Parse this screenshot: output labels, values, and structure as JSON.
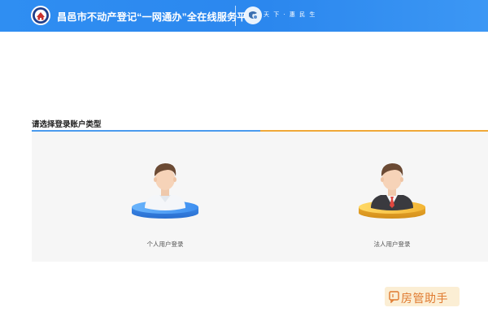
{
  "header": {
    "title": "昌邑市不动产登记“一网通办”全在线服务平台",
    "slogan": "天 下 · 惠 民 生",
    "background": "#2f8ef2"
  },
  "section": {
    "title": "请选择登录账户类型"
  },
  "login_options": [
    {
      "label": "个人用户登录",
      "icon": "person-avatar-icon",
      "accent": "#4a9bee"
    },
    {
      "label": "法人用户登录",
      "icon": "businessman-avatar-icon",
      "accent": "#f0a838"
    }
  ],
  "watermark": {
    "text": "房管助手"
  }
}
